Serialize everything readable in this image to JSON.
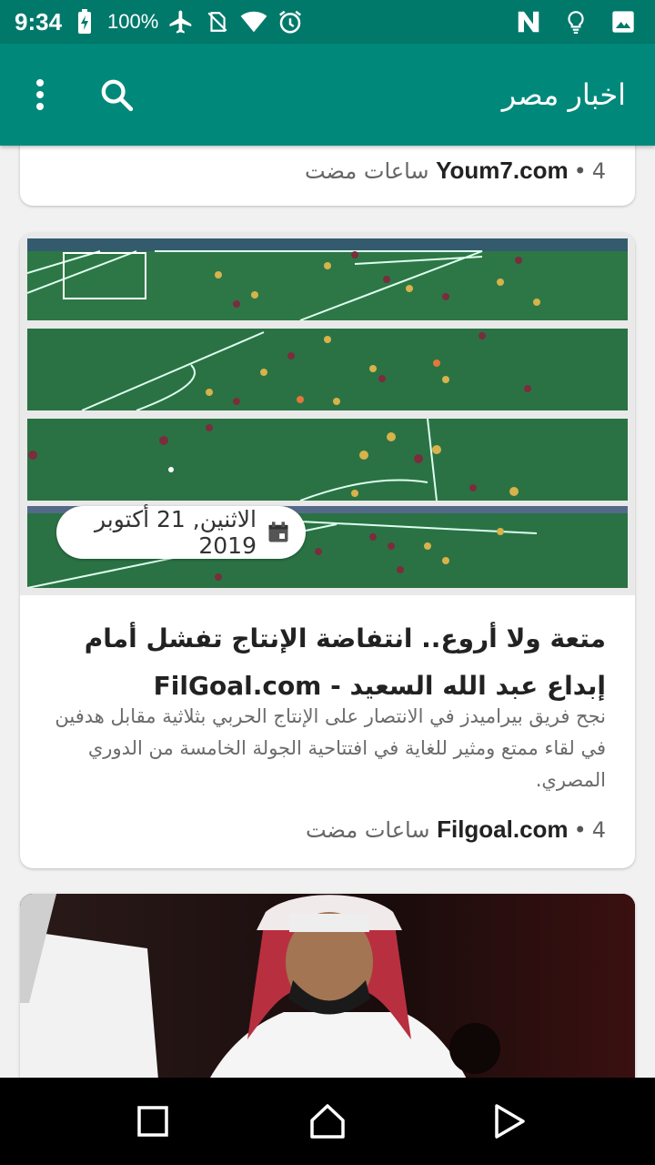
{
  "status_bar": {
    "time": "9:34",
    "battery_percent": "100%",
    "icons_left": [
      "battery-charging-icon",
      "airplane-mode-icon",
      "no-sim-icon",
      "wifi-icon",
      "alarm-icon"
    ],
    "icons_right": [
      "nfc-icon",
      "lightbulb-icon",
      "image-icon"
    ]
  },
  "app_bar": {
    "title": "اخبار مصر",
    "menu_icon": "overflow-menu-icon",
    "search_icon": "search-icon",
    "color": "#00897b"
  },
  "cards": [
    {
      "source": "Youm7.com",
      "time": "4 ساعات مضت"
    },
    {
      "date": "الاثنين, 21 أكتوبر 2019",
      "headline": "متعة ولا أروع.. انتفاضة الإنتاج تفشل أمام إبداع عبد الله السعيد - FilGoal.com",
      "summary": "نجح فريق بيراميدز في الانتصار على الإنتاج الحربي بثلاثية مقابل هدفين في لقاء ممتع ومثير للغاية في افتتاحية الجولة الخامسة من الدوري المصري.",
      "source": "Filgoal.com",
      "time": "4 ساعات مضت"
    },
    {
      "image": "photo-man-in-keffiyeh"
    }
  ],
  "nav_bar": {
    "buttons": [
      "recents-icon",
      "home-icon",
      "back-icon"
    ]
  }
}
